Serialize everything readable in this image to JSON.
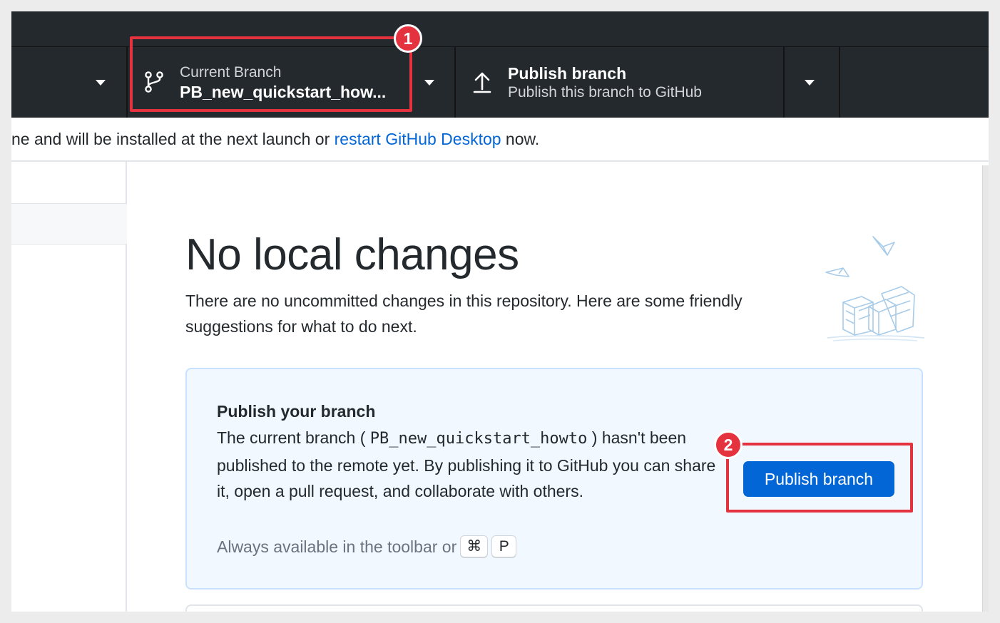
{
  "toolbar": {
    "current_branch": {
      "label": "Current Branch",
      "name": "PB_new_quickstart_how..."
    },
    "publish": {
      "title": "Publish branch",
      "subtitle": "Publish this branch to GitHub"
    }
  },
  "banner": {
    "text_before": "ne and will be installed at the next launch or ",
    "link": "restart GitHub Desktop",
    "text_after": " now."
  },
  "main": {
    "title": "No local changes",
    "description": "There are no uncommitted changes in this repository. Here are some friendly suggestions for what to do next.",
    "publish_card": {
      "title": "Publish your branch",
      "body_prefix": "The current branch ( ",
      "branch_name": "PB_new_quickstart_howto",
      "body_suffix": " ) hasn't been published to the remote yet. By publishing it to GitHub you can share it, open a pull request, and collaborate with others.",
      "hint": "Always available in the toolbar or",
      "shortcut": [
        "⌘",
        "P"
      ],
      "button_label": "Publish branch"
    }
  },
  "annotations": {
    "badge_1": "1",
    "badge_2": "2",
    "color": "#e5323f"
  },
  "colors": {
    "toolbar_bg": "#24292e",
    "accent": "#0366d6",
    "card_bg": "#f1f8ff"
  }
}
